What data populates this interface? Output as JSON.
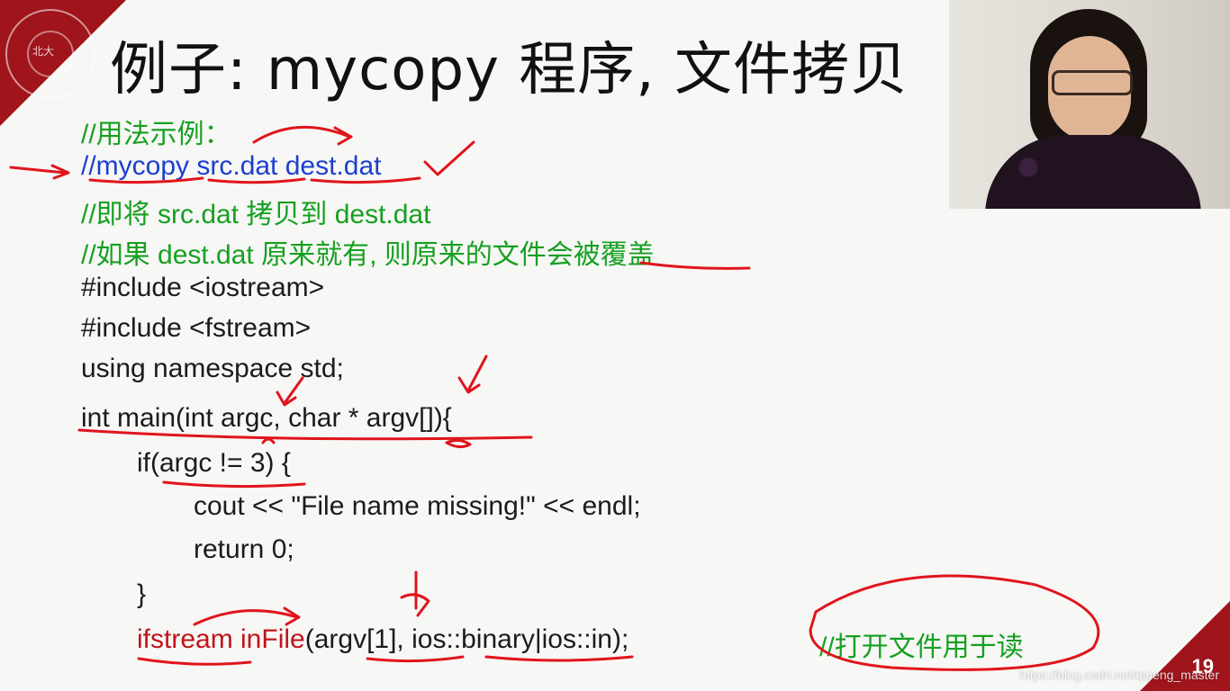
{
  "title": "例子: mycopy 程序, 文件拷贝",
  "code": {
    "c1": "//用法示例：",
    "c2": "//mycopy src.dat dest.dat",
    "c3": "//即将 src.dat 拷贝到 dest.dat",
    "c4": "//如果 dest.dat 原来就有, 则原来的文件会被覆盖",
    "inc1": "#include <iostream>",
    "inc2": "#include <fstream>",
    "using": "using namespace std;",
    "main": "int main(int argc, char * argv[]){",
    "if_line": "if(argc != 3) {",
    "cout_line": "cout << \"File name missing!\" << endl;",
    "return_line": "return 0;",
    "close_brace": "}",
    "ifstream_kw": "ifstream inFile",
    "ifstream_rest": "(argv[1], ios::binary|ios::in);",
    "read_comment": "//打开文件用于读"
  },
  "page_number": "19",
  "watermark": "https://blog.csdn.net/qipeng_master",
  "colors": {
    "accent_red": "#a0141c",
    "comment_green": "#16a021",
    "link_blue": "#1c3fd0",
    "ink_red": "#e0141c"
  }
}
